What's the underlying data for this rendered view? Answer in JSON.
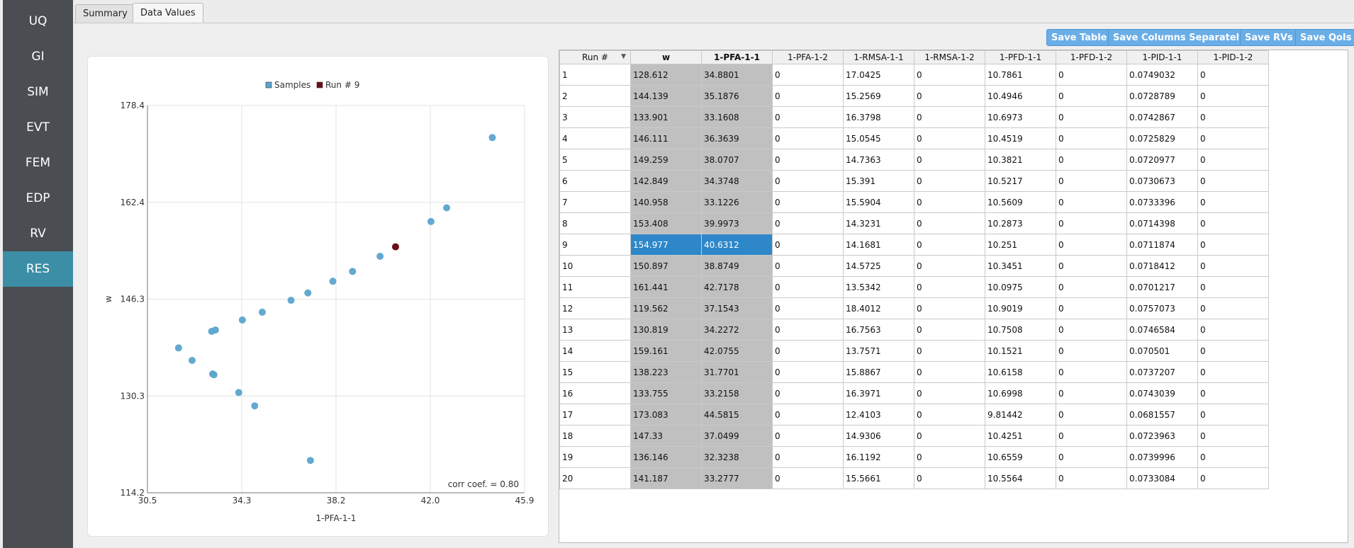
{
  "sidebar": {
    "items": [
      {
        "label": "UQ"
      },
      {
        "label": "GI"
      },
      {
        "label": "SIM"
      },
      {
        "label": "EVT"
      },
      {
        "label": "FEM"
      },
      {
        "label": "EDP"
      },
      {
        "label": "RV"
      },
      {
        "label": "RES",
        "active": true
      }
    ]
  },
  "tabs": [
    {
      "label": "Summary",
      "active": false
    },
    {
      "label": "Data Values",
      "active": true
    }
  ],
  "toolbar": {
    "save_table": "Save Table",
    "save_columns": "Save Columns Separately",
    "save_rvs": "Save RVs",
    "save_qois": "Save QoIs"
  },
  "colors": {
    "accent": "#3b8ea6",
    "sample_point": "#5ba4cf",
    "selected_point": "#6b0e17",
    "selected_cell": "#2e87c9",
    "highlight_column": "#c0c0c0",
    "button": "#6aaee8"
  },
  "chart_data": {
    "type": "scatter",
    "xlabel": "1-PFA-1-1",
    "ylabel": "w",
    "xlim": [
      30.5,
      45.9
    ],
    "ylim": [
      114.2,
      178.4
    ],
    "xticks": [
      "30.5",
      "34.3",
      "38.2",
      "42.0",
      "45.9"
    ],
    "yticks": [
      "114.2",
      "130.3",
      "146.3",
      "162.4",
      "178.4"
    ],
    "grid": true,
    "legend_position": "top-center",
    "legend": [
      {
        "name": "Samples",
        "color": "#5ba4cf"
      },
      {
        "name": "Run # 9",
        "color": "#6b0e17"
      }
    ],
    "annotation": "corr coef. = 0.80",
    "series": [
      {
        "name": "Samples",
        "points": [
          [
            34.8801,
            128.612
          ],
          [
            35.1876,
            144.139
          ],
          [
            33.1608,
            133.901
          ],
          [
            36.3639,
            146.111
          ],
          [
            38.0707,
            149.259
          ],
          [
            34.3748,
            142.849
          ],
          [
            33.1226,
            140.958
          ],
          [
            39.9973,
            153.408
          ],
          [
            38.8749,
            150.897
          ],
          [
            42.7178,
            161.441
          ],
          [
            37.1543,
            119.562
          ],
          [
            34.2272,
            130.819
          ],
          [
            42.0755,
            159.161
          ],
          [
            31.7701,
            138.223
          ],
          [
            33.2158,
            133.755
          ],
          [
            44.5815,
            173.083
          ],
          [
            37.0499,
            147.33
          ],
          [
            32.3238,
            136.146
          ],
          [
            33.2777,
            141.187
          ]
        ]
      },
      {
        "name": "Run # 9",
        "points": [
          [
            40.6312,
            154.977
          ]
        ]
      }
    ]
  },
  "table": {
    "columns": [
      {
        "label": "Run #",
        "bold": false,
        "sortable": true
      },
      {
        "label": "w",
        "bold": true
      },
      {
        "label": "1-PFA-1-1",
        "bold": true
      },
      {
        "label": "1-PFA-1-2",
        "bold": false
      },
      {
        "label": "1-RMSA-1-1",
        "bold": false
      },
      {
        "label": "1-RMSA-1-2",
        "bold": false
      },
      {
        "label": "1-PFD-1-1",
        "bold": false
      },
      {
        "label": "1-PFD-1-2",
        "bold": false
      },
      {
        "label": "1-PID-1-1",
        "bold": false
      },
      {
        "label": "1-PID-1-2",
        "bold": false
      }
    ],
    "highlight_columns": [
      1,
      2
    ],
    "selected_row": 8,
    "rows": [
      [
        "1",
        "128.612",
        "34.8801",
        "0",
        "17.0425",
        "0",
        "10.7861",
        "0",
        "0.0749032",
        "0"
      ],
      [
        "2",
        "144.139",
        "35.1876",
        "0",
        "15.2569",
        "0",
        "10.4946",
        "0",
        "0.0728789",
        "0"
      ],
      [
        "3",
        "133.901",
        "33.1608",
        "0",
        "16.3798",
        "0",
        "10.6973",
        "0",
        "0.0742867",
        "0"
      ],
      [
        "4",
        "146.111",
        "36.3639",
        "0",
        "15.0545",
        "0",
        "10.4519",
        "0",
        "0.0725829",
        "0"
      ],
      [
        "5",
        "149.259",
        "38.0707",
        "0",
        "14.7363",
        "0",
        "10.3821",
        "0",
        "0.0720977",
        "0"
      ],
      [
        "6",
        "142.849",
        "34.3748",
        "0",
        "15.391",
        "0",
        "10.5217",
        "0",
        "0.0730673",
        "0"
      ],
      [
        "7",
        "140.958",
        "33.1226",
        "0",
        "15.5904",
        "0",
        "10.5609",
        "0",
        "0.0733396",
        "0"
      ],
      [
        "8",
        "153.408",
        "39.9973",
        "0",
        "14.3231",
        "0",
        "10.2873",
        "0",
        "0.0714398",
        "0"
      ],
      [
        "9",
        "154.977",
        "40.6312",
        "0",
        "14.1681",
        "0",
        "10.251",
        "0",
        "0.0711874",
        "0"
      ],
      [
        "10",
        "150.897",
        "38.8749",
        "0",
        "14.5725",
        "0",
        "10.3451",
        "0",
        "0.0718412",
        "0"
      ],
      [
        "11",
        "161.441",
        "42.7178",
        "0",
        "13.5342",
        "0",
        "10.0975",
        "0",
        "0.0701217",
        "0"
      ],
      [
        "12",
        "119.562",
        "37.1543",
        "0",
        "18.4012",
        "0",
        "10.9019",
        "0",
        "0.0757073",
        "0"
      ],
      [
        "13",
        "130.819",
        "34.2272",
        "0",
        "16.7563",
        "0",
        "10.7508",
        "0",
        "0.0746584",
        "0"
      ],
      [
        "14",
        "159.161",
        "42.0755",
        "0",
        "13.7571",
        "0",
        "10.1521",
        "0",
        "0.070501",
        "0"
      ],
      [
        "15",
        "138.223",
        "31.7701",
        "0",
        "15.8867",
        "0",
        "10.6158",
        "0",
        "0.0737207",
        "0"
      ],
      [
        "16",
        "133.755",
        "33.2158",
        "0",
        "16.3971",
        "0",
        "10.6998",
        "0",
        "0.0743039",
        "0"
      ],
      [
        "17",
        "173.083",
        "44.5815",
        "0",
        "12.4103",
        "0",
        "9.81442",
        "0",
        "0.0681557",
        "0"
      ],
      [
        "18",
        "147.33",
        "37.0499",
        "0",
        "14.9306",
        "0",
        "10.4251",
        "0",
        "0.0723963",
        "0"
      ],
      [
        "19",
        "136.146",
        "32.3238",
        "0",
        "16.1192",
        "0",
        "10.6559",
        "0",
        "0.0739996",
        "0"
      ],
      [
        "20",
        "141.187",
        "33.2777",
        "0",
        "15.5661",
        "0",
        "10.5564",
        "0",
        "0.0733084",
        "0"
      ]
    ]
  }
}
